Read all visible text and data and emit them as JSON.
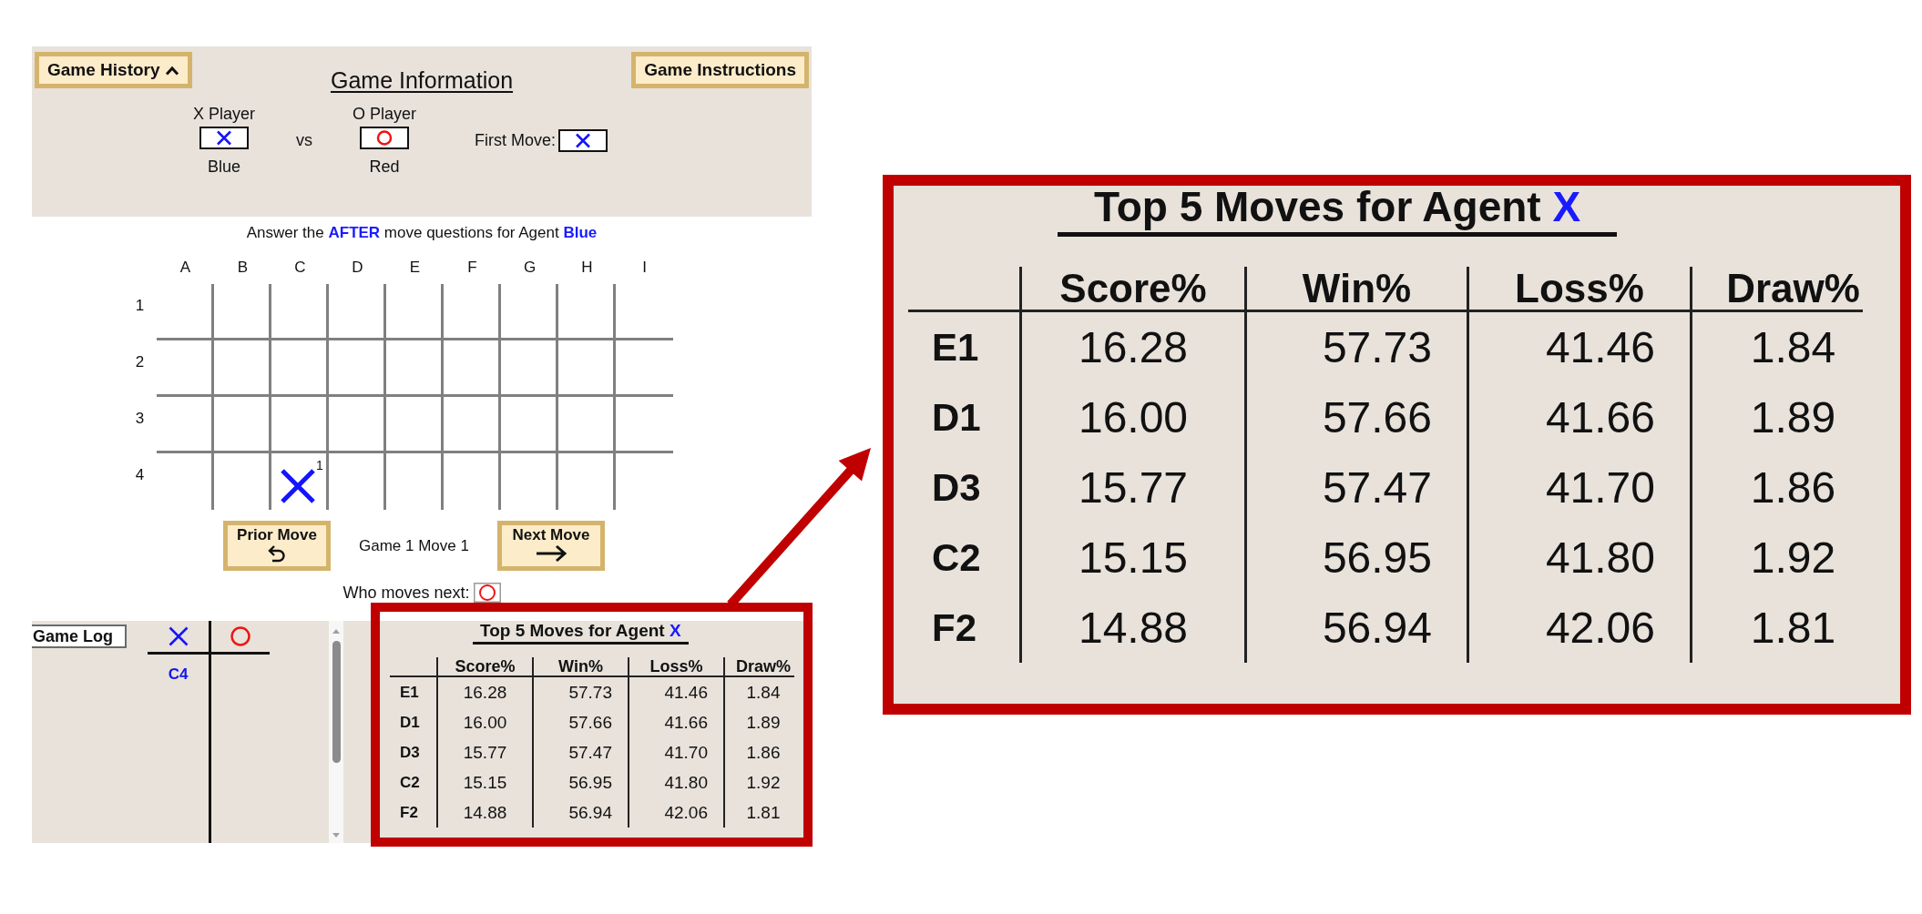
{
  "game_info": {
    "history_button": "Game History",
    "title": "Game Information",
    "instructions_button": "Game Instructions",
    "players": [
      {
        "label": "X Player",
        "kind": "x",
        "color_label": "Blue"
      },
      {
        "label": "O Player",
        "kind": "o",
        "color_label": "Red"
      }
    ],
    "vs": "vs",
    "first_move": {
      "label": "First Move:",
      "kind": "x"
    }
  },
  "prompt": "Answer the **AFTER** move questions for Agent **Blue**",
  "board": {
    "columns": [
      "A",
      "B",
      "C",
      "D",
      "E",
      "F",
      "G",
      "H",
      "I"
    ],
    "rows": [
      {
        "label": "1",
        "cells": [
          {},
          {},
          {},
          {},
          {},
          {},
          {},
          {},
          {}
        ]
      },
      {
        "label": "2",
        "cells": [
          {},
          {},
          {},
          {},
          {},
          {},
          {},
          {},
          {}
        ]
      },
      {
        "label": "3",
        "cells": [
          {},
          {},
          {},
          {},
          {},
          {},
          {},
          {},
          {}
        ]
      },
      {
        "label": "4",
        "cells": [
          {},
          {},
          {
            "kind": "x",
            "move_number": "1"
          },
          {},
          {},
          {},
          {},
          {},
          {}
        ]
      }
    ]
  },
  "navigation": {
    "prior_button": "Prior Move",
    "status": "Game 1 Move 1",
    "next_button": "Next Move"
  },
  "next_turn": {
    "label": "Who moves next:",
    "kind": "o"
  },
  "game_log": {
    "title": "Game Log",
    "columns": [
      {
        "kind": "x"
      },
      {
        "kind": "o"
      }
    ],
    "rows": [
      {
        "cells": [
          "C4"
        ]
      }
    ]
  },
  "top_moves": {
    "title": "Top 5 Moves for Agent",
    "agent": "X",
    "columns": [
      "Score%",
      "Win%",
      "Loss%",
      "Draw%"
    ],
    "rows": [
      {
        "move": "E1",
        "values": [
          "16.28",
          "57.73",
          "41.46",
          "1.84"
        ]
      },
      {
        "move": "D1",
        "values": [
          "16.00",
          "57.66",
          "41.66",
          "1.89"
        ]
      },
      {
        "move": "D3",
        "values": [
          "15.77",
          "57.47",
          "41.70",
          "1.86"
        ]
      },
      {
        "move": "C2",
        "values": [
          "15.15",
          "56.95",
          "41.80",
          "1.92"
        ]
      },
      {
        "move": "F2",
        "values": [
          "14.88",
          "56.94",
          "42.06",
          "1.81"
        ]
      }
    ]
  },
  "callout": {
    "table": {
      "title": "Top 5 Moves for Agent",
      "agent": "X",
      "columns": [
        "Score%",
        "Win%",
        "Loss%",
        "Draw%"
      ],
      "rows": [
        {
          "move": "E1",
          "values": [
            "16.28",
            "57.73",
            "41.46",
            "1.84"
          ]
        },
        {
          "move": "D1",
          "values": [
            "16.00",
            "57.66",
            "41.66",
            "1.89"
          ]
        },
        {
          "move": "D3",
          "values": [
            "15.77",
            "57.47",
            "41.70",
            "1.86"
          ]
        },
        {
          "move": "C2",
          "values": [
            "15.15",
            "56.95",
            "41.80",
            "1.92"
          ]
        },
        {
          "move": "F2",
          "values": [
            "14.88",
            "56.94",
            "42.06",
            "1.81"
          ]
        }
      ]
    }
  }
}
